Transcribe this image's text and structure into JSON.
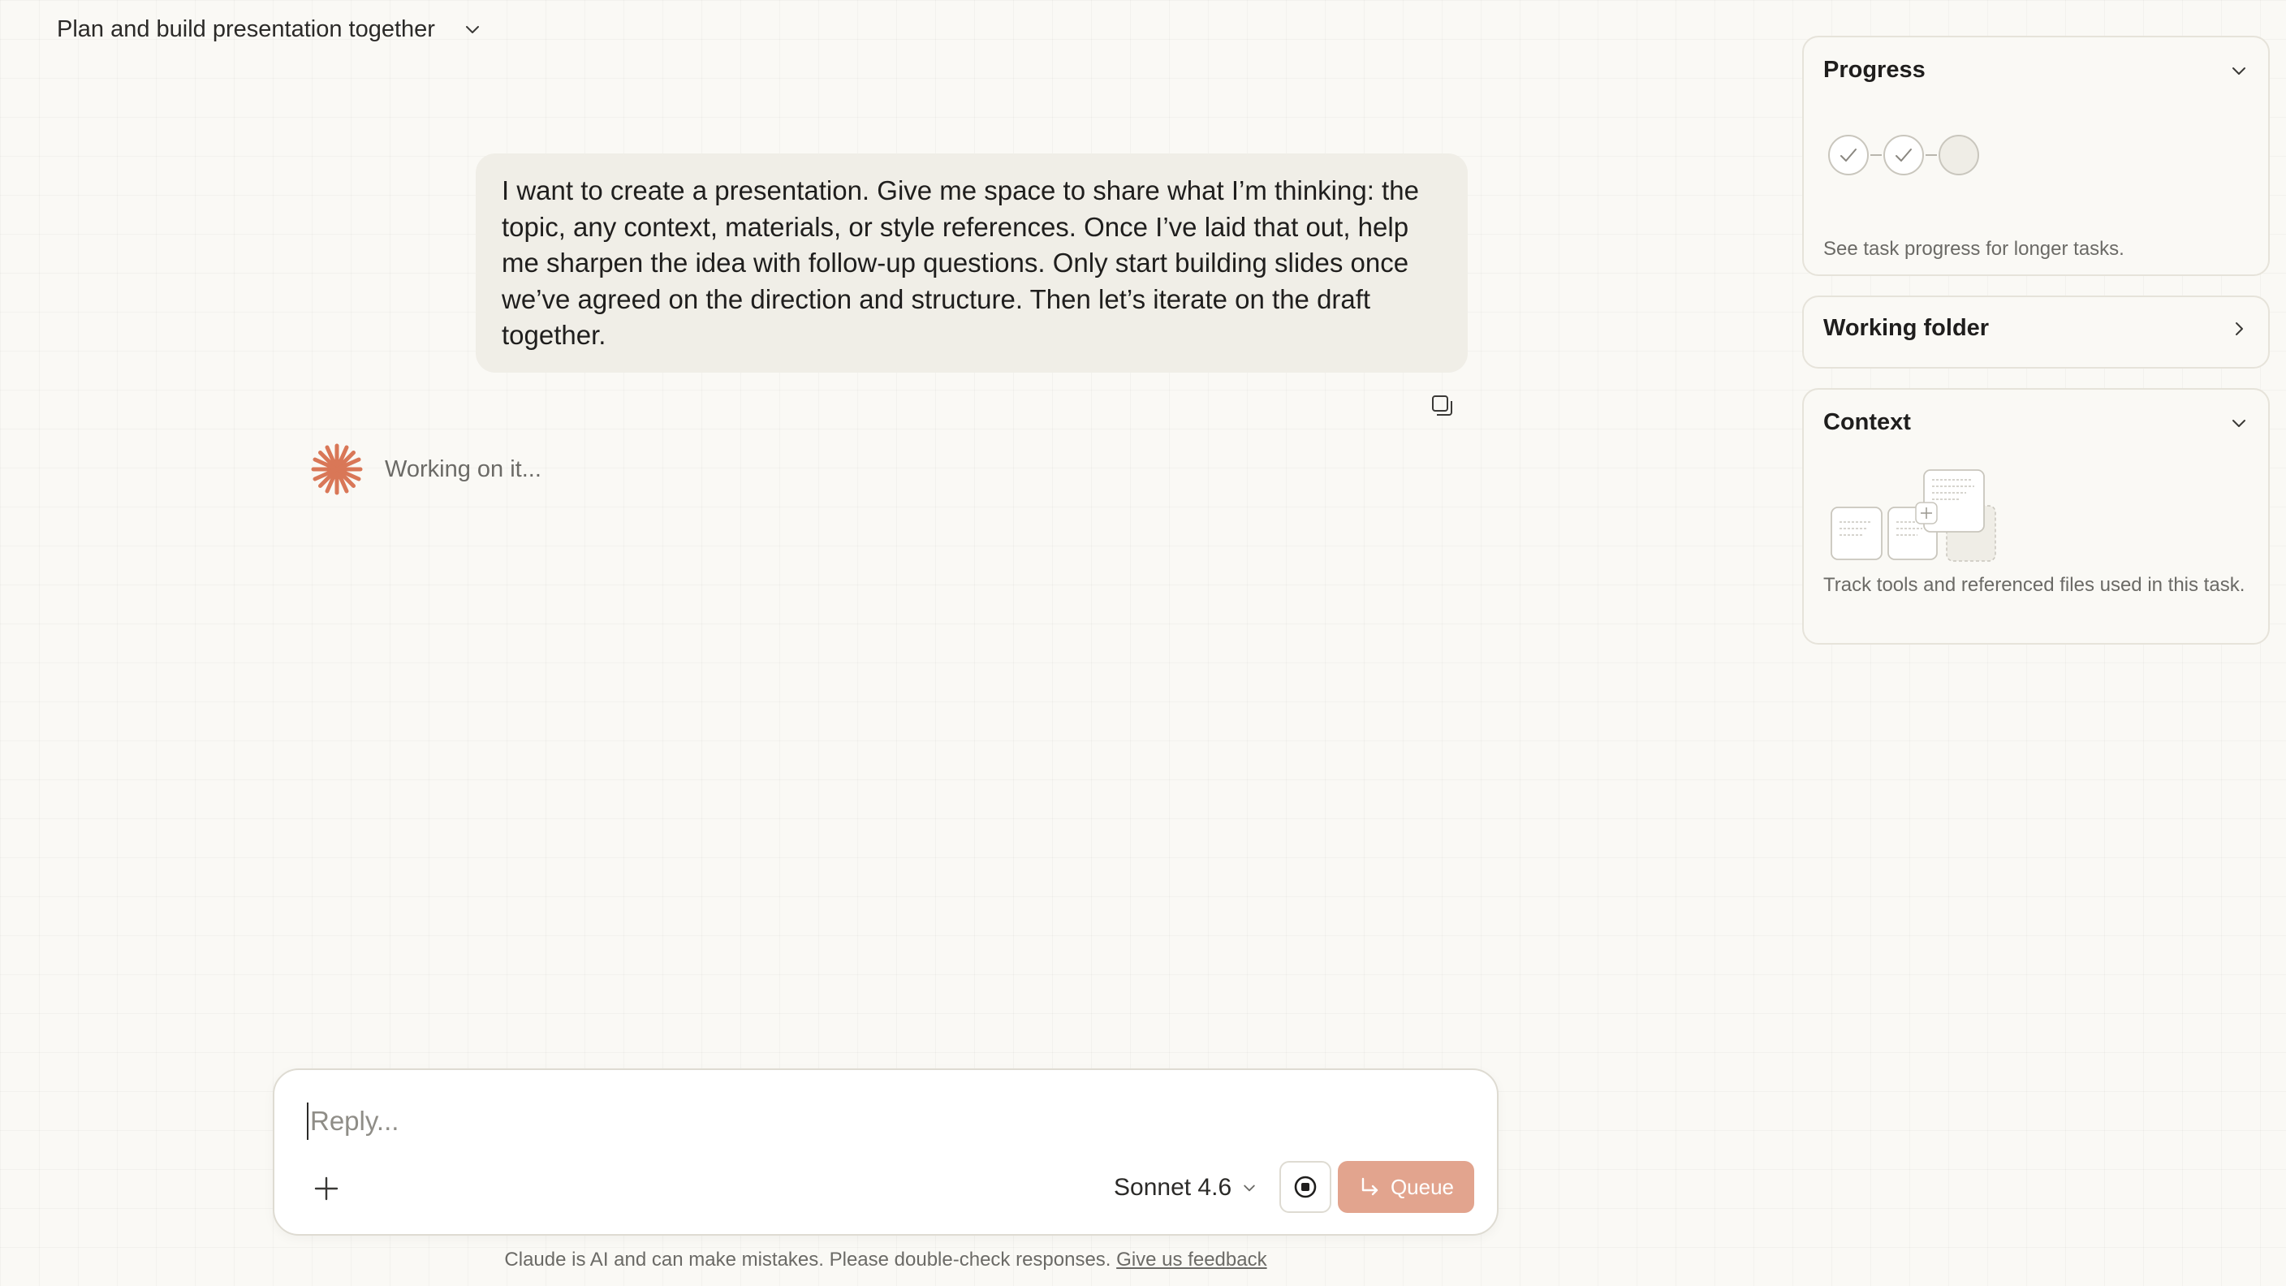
{
  "header": {
    "title": "Plan and build presentation together",
    "dropdown_icon": "chevron-down-icon"
  },
  "conversation": {
    "user_message": "I want to create a presentation. Give me space to share what I’m thinking: the topic, any context, materials, or style references. Once I’ve laid that out, help me sharpen the idea with follow-up questions. Only start building slides once we’ve agreed on the direction and structure. Then let’s iterate on the draft together.",
    "copy_icon": "copy-icon",
    "assistant_status": "Working on it...",
    "assistant_icon": "claude-spark-icon",
    "accent_color": "#d97757"
  },
  "panel": {
    "progress": {
      "title": "Progress",
      "description": "See task progress for longer tasks.",
      "steps": [
        {
          "state": "done"
        },
        {
          "state": "done"
        },
        {
          "state": "pending"
        }
      ]
    },
    "working_folder": {
      "title": "Working folder"
    },
    "context": {
      "title": "Context",
      "description": "Track tools and referenced files used in this task."
    }
  },
  "composer": {
    "placeholder": "Reply...",
    "value": "",
    "model": "Sonnet 4.6",
    "queue_label": "Queue",
    "queue_color": "#e2a48e"
  },
  "footer": {
    "disclaimer": "Claude is AI and can make mistakes. Please double-check responses.",
    "feedback_link": "Give us feedback"
  }
}
